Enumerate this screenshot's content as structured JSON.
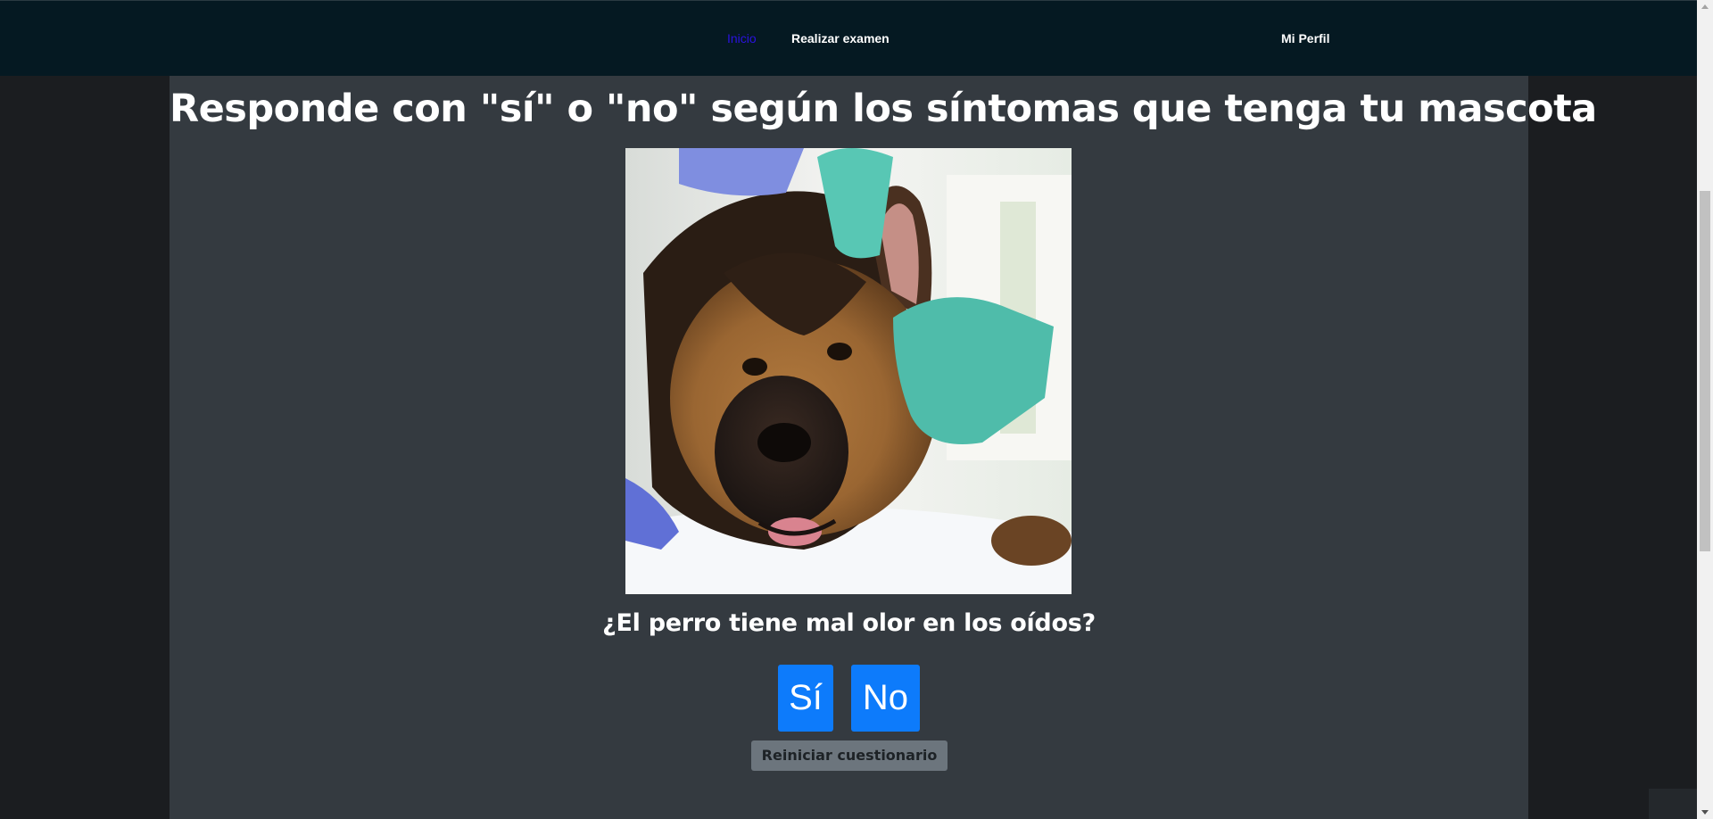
{
  "nav": {
    "home": "Inicio",
    "exam": "Realizar examen",
    "profile": "Mi Perfil",
    "active_color": "#2b12e0"
  },
  "quiz": {
    "title": "Responde con \"sí\" o \"no\" según los síntomas que tenga tu mascota",
    "question": "¿El perro tiene mal olor en los oídos?",
    "yes_label": "Sí",
    "no_label": "No",
    "reset_label": "Reiniciar cuestionario",
    "button_color": "#0d7bfb"
  },
  "image": {
    "subject": "german-shepherd-vet-exam"
  }
}
